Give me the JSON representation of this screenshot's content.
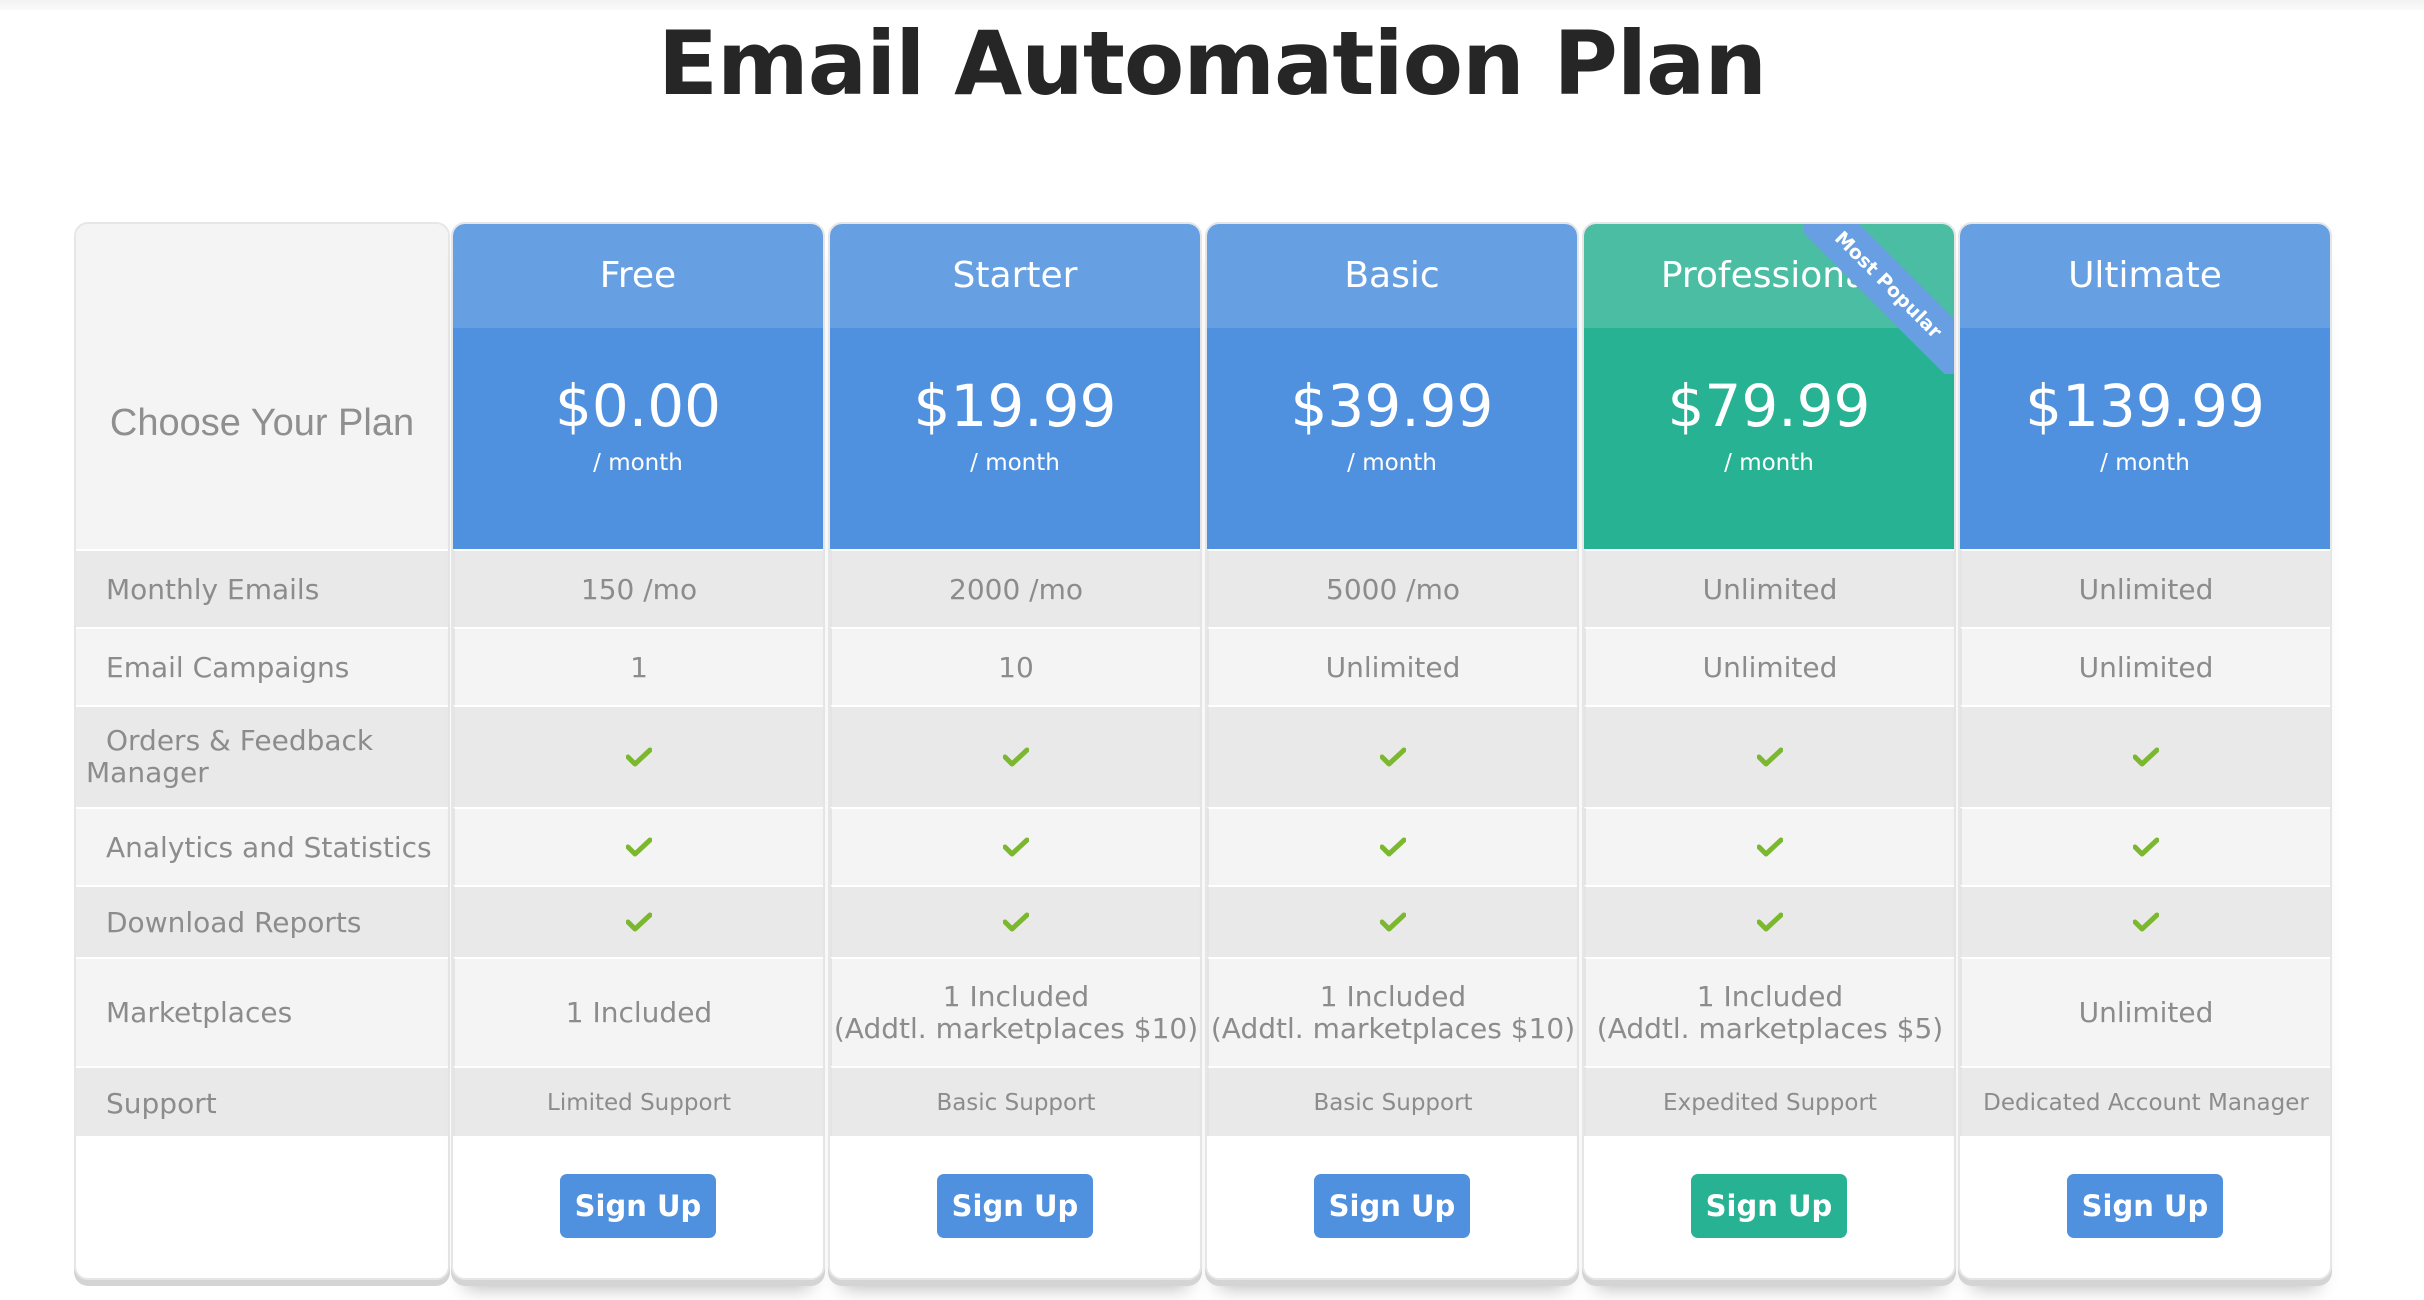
{
  "page": {
    "title": "Email Automation Plan"
  },
  "colors": {
    "blue_header": "#67a0e2",
    "blue_price": "#4f91df",
    "green_header": "#4abda3",
    "green_price": "#28b294",
    "check": "#7cb82f",
    "ribbon": "#679fe2"
  },
  "table": {
    "corner_label": "Choose Your Plan",
    "features": [
      "Monthly Emails",
      "Email Campaigns",
      "Orders & Feedback Manager",
      "Analytics and Statistics",
      "Download Reports",
      "Marketplaces",
      "Support"
    ],
    "plans": [
      {
        "name": "Free",
        "price": "$0.00",
        "period": "/ month",
        "highlight": false,
        "monthly_emails": "150 /mo",
        "email_campaigns": "1",
        "orders_feedback": "check",
        "analytics": "check",
        "download_reports": "check",
        "marketplaces_line1": "1 Included",
        "marketplaces_line2": "",
        "support": "Limited Support",
        "button": "Sign Up"
      },
      {
        "name": "Starter",
        "price": "$19.99",
        "period": "/ month",
        "highlight": false,
        "monthly_emails": "2000 /mo",
        "email_campaigns": "10",
        "orders_feedback": "check",
        "analytics": "check",
        "download_reports": "check",
        "marketplaces_line1": "1 Included",
        "marketplaces_line2": "(Addtl. marketplaces $10)",
        "support": "Basic Support",
        "button": "Sign Up"
      },
      {
        "name": "Basic",
        "price": "$39.99",
        "period": "/ month",
        "highlight": false,
        "monthly_emails": "5000 /mo",
        "email_campaigns": "Unlimited",
        "orders_feedback": "check",
        "analytics": "check",
        "download_reports": "check",
        "marketplaces_line1": "1 Included",
        "marketplaces_line2": "(Addtl. marketplaces $10)",
        "support": "Basic Support",
        "button": "Sign Up"
      },
      {
        "name": "Professional",
        "price": "$79.99",
        "period": "/ month",
        "highlight": true,
        "ribbon": "Most Popular",
        "monthly_emails": "Unlimited",
        "email_campaigns": "Unlimited",
        "orders_feedback": "check",
        "analytics": "check",
        "download_reports": "check",
        "marketplaces_line1": "1 Included",
        "marketplaces_line2": "(Addtl. marketplaces $5)",
        "support": "Expedited Support",
        "button": "Sign Up"
      },
      {
        "name": "Ultimate",
        "price": "$139.99",
        "period": "/ month",
        "highlight": false,
        "monthly_emails": "Unlimited",
        "email_campaigns": "Unlimited",
        "orders_feedback": "check",
        "analytics": "check",
        "download_reports": "check",
        "marketplaces_line1": "Unlimited",
        "marketplaces_line2": "",
        "support": "Dedicated Account Manager",
        "button": "Sign Up"
      }
    ],
    "check_icon": "checkmark-icon"
  }
}
